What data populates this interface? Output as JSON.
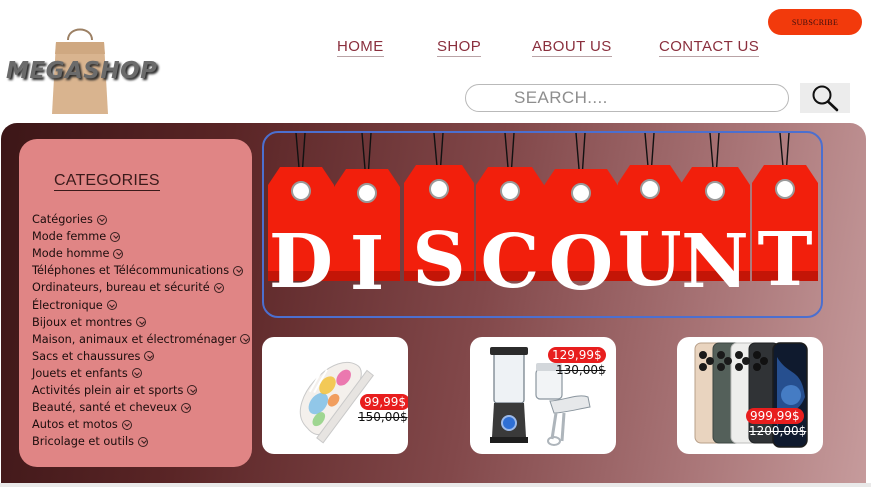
{
  "brand": {
    "name": "MEGASHOP"
  },
  "header": {
    "subscribe_label": "SUBSCRIBE",
    "nav": [
      {
        "label": "HOME"
      },
      {
        "label": "SHOP"
      },
      {
        "label": "ABOUT US"
      },
      {
        "label": "CONTACT US"
      }
    ],
    "search": {
      "placeholder": "SEARCH...."
    }
  },
  "sidebar": {
    "title": "CATEGORIES",
    "items": [
      {
        "label": "Catégories"
      },
      {
        "label": "Mode femme"
      },
      {
        "label": "Mode homme"
      },
      {
        "label": "Téléphones et Télécommunications"
      },
      {
        "label": "Ordinateurs, bureau et sécurité"
      },
      {
        "label": "Électronique"
      },
      {
        "label": "Bijoux et montres"
      },
      {
        "label": "Maison, animaux et électroménager"
      },
      {
        "label": "Sacs et chaussures"
      },
      {
        "label": "Jouets et enfants"
      },
      {
        "label": "Activités plein air et sports"
      },
      {
        "label": "Beauté, santé et cheveux"
      },
      {
        "label": "Autos et motos"
      },
      {
        "label": "Bricolage et outils"
      }
    ]
  },
  "banner": {
    "letters": [
      "D",
      "I",
      "S",
      "C",
      "O",
      "U",
      "N",
      "T"
    ]
  },
  "products": [
    {
      "new_price": "99,99$",
      "old_price": "150,00$"
    },
    {
      "new_price": "129,99$",
      "old_price": "130,00$"
    },
    {
      "new_price": "999,99$",
      "old_price": "1200,00$"
    }
  ],
  "colors": {
    "accent": "#f23a0c",
    "nav_text": "#8a2f3d",
    "sidebar_bg": "#e08585",
    "tag_red": "#f21f0c",
    "banner_border": "#4c6fcf",
    "price_badge": "#e81e1e"
  }
}
